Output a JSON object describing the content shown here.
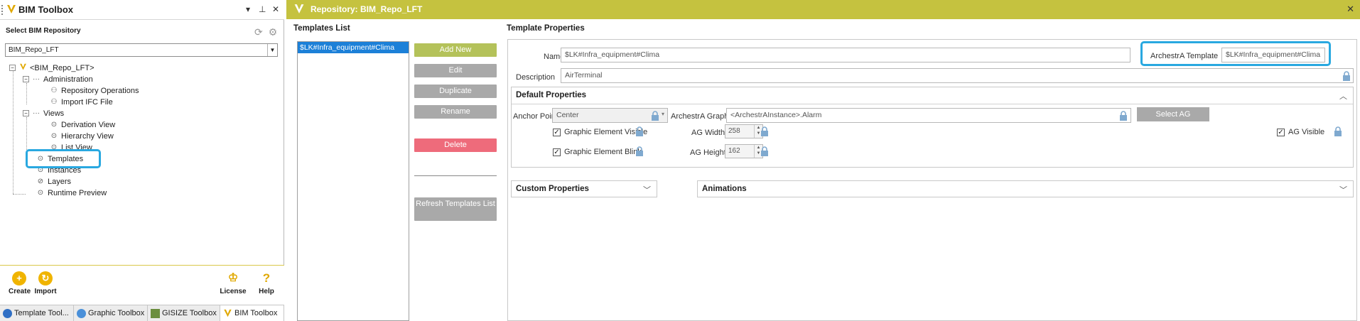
{
  "left_panel": {
    "title": "BIM Toolbox",
    "pin_icon": "pin-icon",
    "repo_label": "Select BIM Repository",
    "repo_value": "BIM_Repo_LFT",
    "tree": {
      "root": "<BIM_Repo_LFT>",
      "administration": "Administration",
      "repository_operations": "Repository Operations",
      "import_ifc": "Import IFC File",
      "views": "Views",
      "derivation_view": "Derivation View",
      "hierarchy_view": "Hierarchy View",
      "list_view": "List View",
      "templates": "Templates",
      "instances": "Instances",
      "layers": "Layers",
      "runtime_preview": "Runtime Preview"
    },
    "toolbar": {
      "create": "Create",
      "import": "Import",
      "license": "License",
      "help": "Help"
    },
    "tabs": [
      "Template Tool...",
      "Graphic Toolbox",
      "GISIZE Toolbox",
      "BIM Toolbox"
    ]
  },
  "main": {
    "header_title": "Repository: BIM_Repo_LFT",
    "templates_list_title": "Templates List",
    "templates": [
      "$LK#Infra_equipment#Clima"
    ],
    "buttons": {
      "add_new": "Add New",
      "edit": "Edit",
      "duplicate": "Duplicate",
      "rename": "Rename",
      "delete": "Delete",
      "refresh": "Refresh Templates List"
    },
    "template_properties_title": "Template Properties",
    "name_label": "Name",
    "name_value": "$LK#Infra_equipment#Clima",
    "archestra_template_label": "ArchestrA Template",
    "archestra_template_value": "$LK#Infra_equipment#Clima",
    "description_label": "Description",
    "description_value": "AirTerminal",
    "default_properties": {
      "title": "Default Properties",
      "anchor_point_label": "Anchor Point",
      "anchor_point_value": "Center",
      "archestra_graphic_label": "ArchestrA Graphic",
      "archestra_graphic_value": "<ArchestrAInstance>.Alarm",
      "select_ag": "Select AG",
      "graphic_element_visible": "Graphic Element Visible",
      "graphic_element_blink": "Graphic Element Blink",
      "ag_width_label": "AG Width",
      "ag_width_value": "258",
      "ag_height_label": "AG Height",
      "ag_height_value": "162",
      "ag_visible": "AG Visible"
    },
    "custom_properties_title": "Custom Properties",
    "animations_title": "Animations"
  },
  "colors": {
    "header_bg": "#c5c23f",
    "add_new": "#b4c25a",
    "delete": "#ee6b7b",
    "grey_btn": "#a9a9a9",
    "selection": "#1c80d8",
    "highlight": "#29a8e0"
  }
}
